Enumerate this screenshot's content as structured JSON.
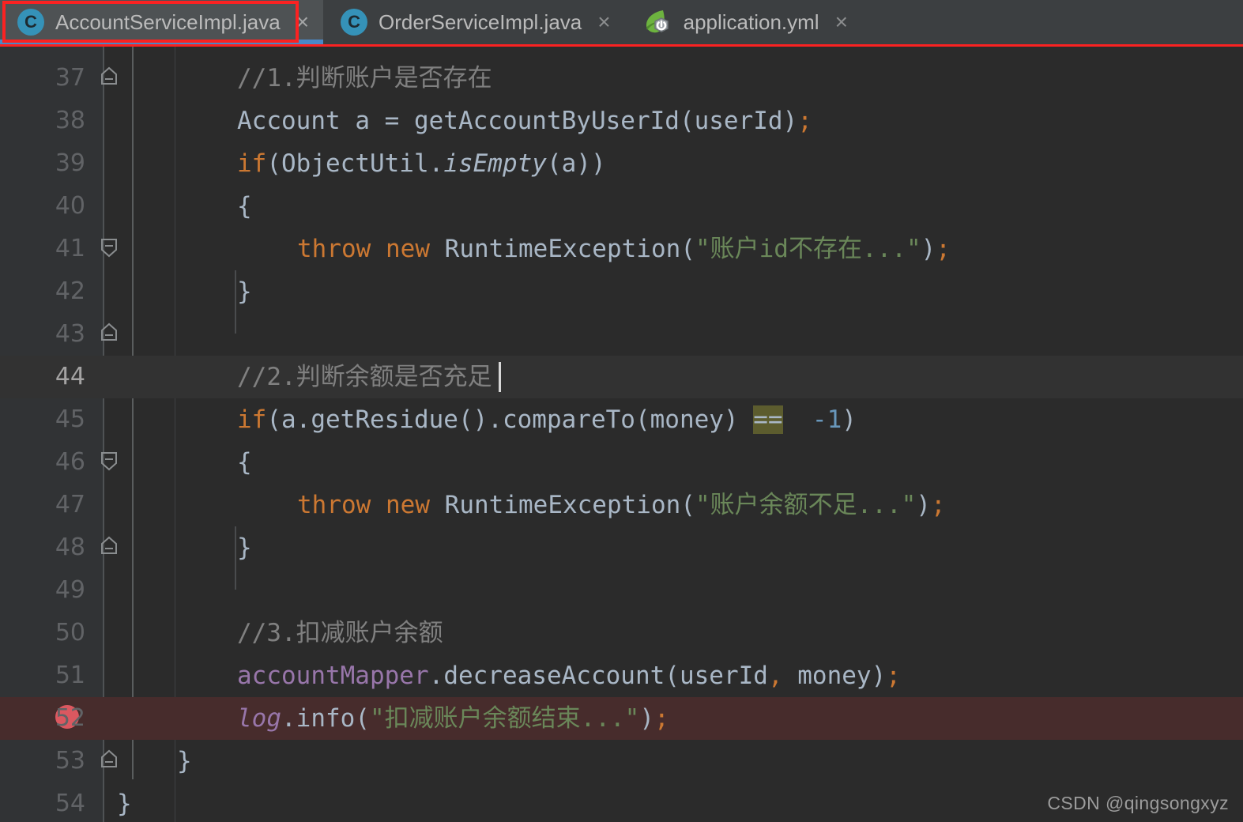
{
  "window": {
    "theme": "Darcula",
    "colors": {
      "tabbar_bg": "#3c3f41",
      "active_tab_bg": "#4e5254",
      "active_tab_underline": "#4a88c7",
      "editor_bg": "#2b2b2b",
      "gutter_bg": "#313335",
      "caret_line_bg": "#323232",
      "breakpoint_line_bg": "#472c2c",
      "breakpoint_dot": "#db5860",
      "annotation_box": "#fb2222",
      "comment": "#808080",
      "keyword": "#cc7832",
      "string": "#6a8759",
      "number": "#6897bb",
      "field": "#9876aa",
      "plain": "#a9b7c6",
      "search_highlight": "#5c5c2e"
    }
  },
  "tabs": [
    {
      "label": "AccountServiceImpl.java",
      "icon": "java-class-icon",
      "active": true,
      "close": "×",
      "icon_letter": "C"
    },
    {
      "label": "OrderServiceImpl.java",
      "icon": "java-class-icon",
      "active": false,
      "close": "×",
      "icon_letter": "C"
    },
    {
      "label": "application.yml",
      "icon": "spring-boot-icon",
      "active": false,
      "close": "×",
      "icon_letter": ""
    }
  ],
  "editor": {
    "file": "AccountServiceImpl.java",
    "caret_line": 44,
    "breakpoint_lines": [
      52
    ],
    "first_visible_line": 37,
    "last_visible_line": 54,
    "lines": [
      {
        "no": "37",
        "text": "    //1.判断账户是否存在"
      },
      {
        "no": "38",
        "text": "    Account a = getAccountByUserId(userId);"
      },
      {
        "no": "39",
        "text": "    if(ObjectUtil.isEmpty(a))"
      },
      {
        "no": "40",
        "text": "    {"
      },
      {
        "no": "41",
        "text": "        throw new RuntimeException(\"账户id不存在...\");"
      },
      {
        "no": "42",
        "text": "    }"
      },
      {
        "no": "43",
        "text": ""
      },
      {
        "no": "44",
        "text": "    //2.判断余额是否充足"
      },
      {
        "no": "45",
        "text": "    if(a.getResidue().compareTo(money) == -1)"
      },
      {
        "no": "46",
        "text": "    {"
      },
      {
        "no": "47",
        "text": "        throw new RuntimeException(\"账户余额不足...\");"
      },
      {
        "no": "48",
        "text": "    }"
      },
      {
        "no": "49",
        "text": ""
      },
      {
        "no": "50",
        "text": "    //3.扣减账户余额"
      },
      {
        "no": "51",
        "text": "    accountMapper.decreaseAccount(userId, money);"
      },
      {
        "no": "52",
        "text": "    log.info(\"扣减账户余额结束...\");"
      },
      {
        "no": "53",
        "text": "  }"
      },
      {
        "no": "54",
        "text": "}"
      }
    ]
  },
  "watermark": {
    "text": "CSDN @qingsongxyz"
  }
}
